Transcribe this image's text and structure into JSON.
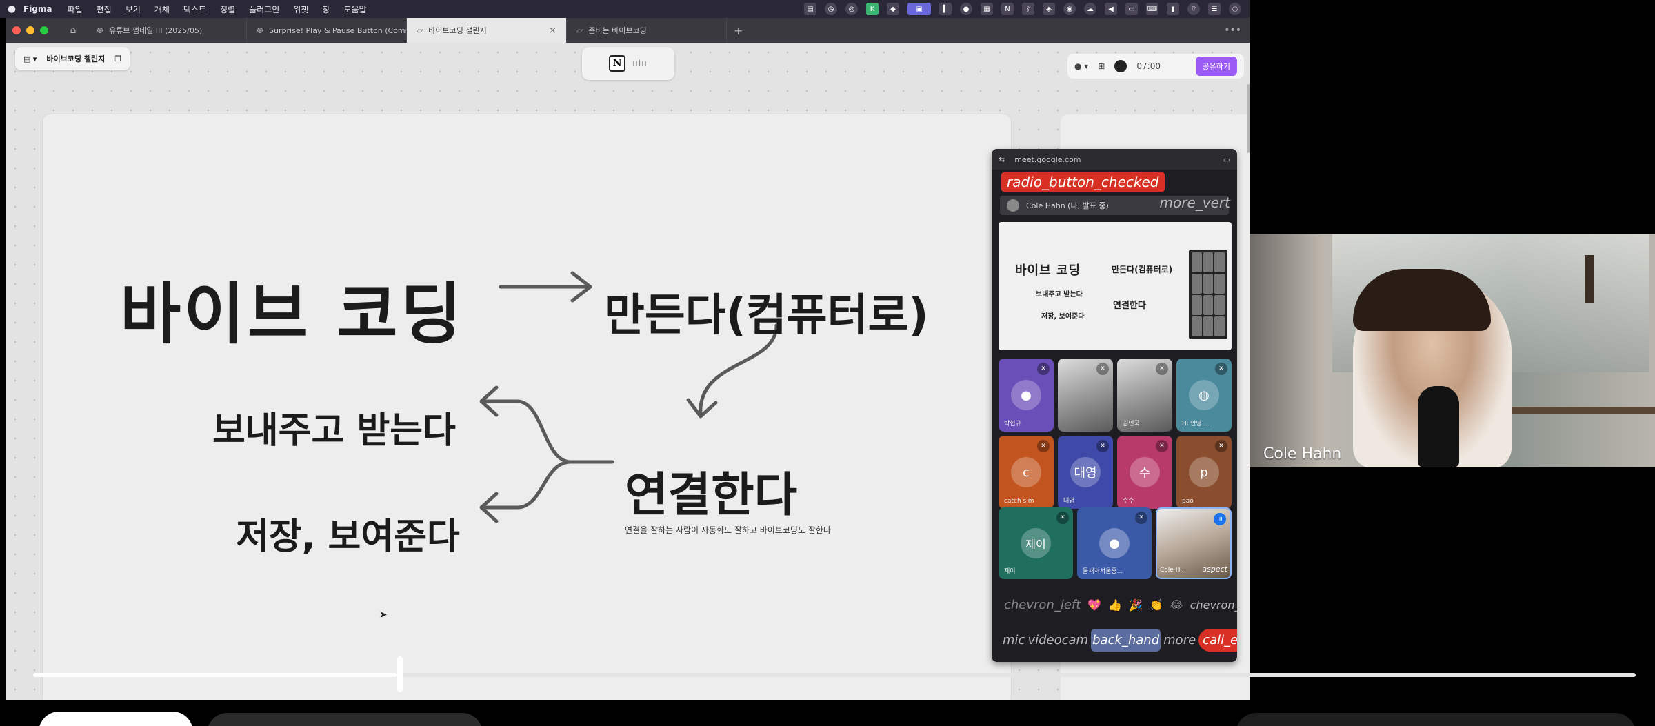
{
  "menubar": {
    "apple": "",
    "app_name": "Figma",
    "items": [
      "파일",
      "편집",
      "보기",
      "개체",
      "텍스트",
      "정렬",
      "플러그인",
      "위젯",
      "창",
      "도움말"
    ]
  },
  "tabs": [
    {
      "label": "유튜브 썸네일 III (2025/05)",
      "icon": "figma-file-icon",
      "active": false
    },
    {
      "label": "Surprise! Play & Pause Button (Comm",
      "icon": "figma-file-icon",
      "active": false
    },
    {
      "label": "바이브코딩 챌린지",
      "icon": "figjam-file-icon",
      "active": true
    },
    {
      "label": "준비는 바이브코딩",
      "icon": "figjam-file-icon",
      "active": false
    }
  ],
  "file_chip": {
    "title": "바이브코딩 챌린지"
  },
  "top_right": {
    "timer": "07:00",
    "share_label": "공유하기"
  },
  "slide": {
    "main": "바이브 코딩",
    "make": "만든다(컴퓨터로)",
    "send": "보내주고 받는다",
    "store": "저장, 보여준다",
    "connect": "연결한다",
    "note": "연결을 잘하는 사람이 자동화도 잘하고 바이브코딩도 잘한다"
  },
  "meet": {
    "url": "meet.google.com",
    "recording_icon_text": "radio_button_checked",
    "presenter_label": "Cole Hahn (나, 발표 중)",
    "more_icon_text": "more_vert",
    "participants": [
      {
        "name": "박현규",
        "initial": "",
        "color": "#6b4fb8",
        "kind": "avatar"
      },
      {
        "name": "",
        "initial": "",
        "color": "#cfcfcf",
        "kind": "photo"
      },
      {
        "name": "김민국",
        "initial": "",
        "color": "#bdbdbd",
        "kind": "photo"
      },
      {
        "name": "Hi 안녕 ...",
        "initial": "",
        "color": "#4a8a9c",
        "kind": "photo"
      },
      {
        "name": "catch sim",
        "initial": "c",
        "color": "#c2541f",
        "kind": "initial"
      },
      {
        "name": "대영",
        "initial": "대영",
        "color": "#3f4aa8",
        "kind": "initial"
      },
      {
        "name": "수수",
        "initial": "수",
        "color": "#b83a6a",
        "kind": "initial"
      },
      {
        "name": "pao",
        "initial": "p",
        "color": "#8a4e2e",
        "kind": "initial"
      },
      {
        "name": "제이",
        "initial": "제이",
        "color": "#1f6e5e",
        "kind": "initial"
      },
      {
        "name": "물새처서울중...",
        "initial": "",
        "color": "#3a5aa8",
        "kind": "avatar"
      },
      {
        "name": "Cole H...",
        "initial": "",
        "color": "#d8d0c8",
        "kind": "photo",
        "extra": "aspect"
      }
    ],
    "reaction_left": "chevron_left",
    "reaction_right": "chevron_right",
    "reactions": [
      "💖",
      "👍",
      "🎉",
      "👏",
      "😂"
    ],
    "controls": [
      "mic",
      "videocam",
      "back_hand",
      "more",
      "call_end"
    ]
  },
  "webcam": {
    "name": "Cole Hahn"
  },
  "player": {
    "progress": 0.227
  }
}
